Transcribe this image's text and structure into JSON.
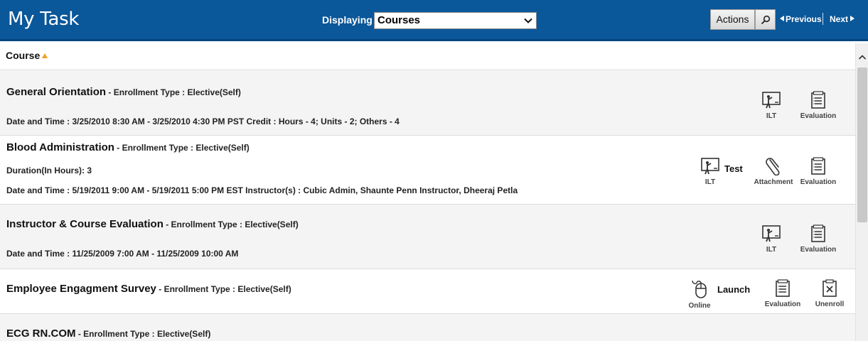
{
  "header": {
    "title": "My Task",
    "displaying_label": "Displaying",
    "displaying_value": "Courses",
    "actions_label": "Actions",
    "previous_label": "Previous",
    "next_label": "Next"
  },
  "column_header": {
    "label": "Course",
    "sort": "ascending"
  },
  "colors": {
    "header_bg": "#0a5799",
    "sort_arrow": "#f0a020",
    "row_shade": "#f4f4f4"
  },
  "rows": [
    {
      "name": "General Orientation",
      "enrollment": " - Enrollment Type : Elective(Self)",
      "details": [
        "Date and Time : 3/25/2010 8:30 AM - 3/25/2010 4:30 PM PST Credit  : Hours - 4; Units - 2; Others - 4"
      ],
      "actions": [
        {
          "label": "ILT",
          "icon": "ilt-icon"
        },
        {
          "label": "Evaluation",
          "icon": "evaluation-icon"
        }
      ]
    },
    {
      "name": "Blood Administration",
      "enrollment": " - Enrollment Type : Elective(Self)",
      "details": [
        "Duration(In Hours): 3",
        "Date and Time : 5/19/2011 9:00 AM - 5/19/2011 5:00 PM EST Instructor(s)  : Cubic Admin, Shaunte Penn Instructor, Dheeraj Petla"
      ],
      "side_label": "Test",
      "actions": [
        {
          "label": "ILT",
          "icon": "ilt-icon"
        },
        {
          "label": "Attachment",
          "icon": "paperclip-icon"
        },
        {
          "label": "Evaluation",
          "icon": "evaluation-icon"
        }
      ]
    },
    {
      "name": "Instructor & Course Evaluation",
      "enrollment": " - Enrollment Type : Elective(Self)",
      "details": [
        "Date and Time : 11/25/2009 7:00 AM - 11/25/2009 10:00 AM"
      ],
      "actions": [
        {
          "label": "ILT",
          "icon": "ilt-icon"
        },
        {
          "label": "Evaluation",
          "icon": "evaluation-icon"
        }
      ]
    },
    {
      "name": "Employee Engagment Survey",
      "enrollment": " - Enrollment Type : Elective(Self)",
      "details": [],
      "side_label": "Launch",
      "actions": [
        {
          "label": "Online",
          "icon": "mouse-icon"
        },
        {
          "label": "Evaluation",
          "icon": "evaluation-icon"
        },
        {
          "label": "Unenroll",
          "icon": "unenroll-icon"
        }
      ]
    },
    {
      "name": "ECG RN.COM",
      "enrollment": " - Enrollment Type : Elective(Self)",
      "details": [],
      "actions": []
    }
  ]
}
